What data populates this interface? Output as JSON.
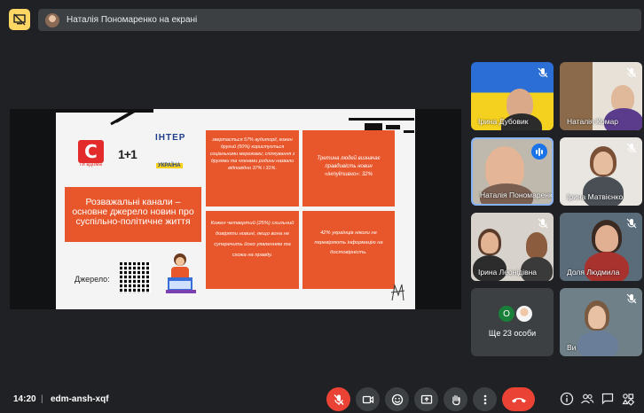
{
  "presenting_banner": {
    "text": "Наталія Пономаренко на екрані"
  },
  "slide": {
    "logos": {
      "stv_mark": "С",
      "stv_sub": "Ти вдома",
      "one_plus_one": "1+1",
      "inter": "ІНТЕР",
      "ukraina": "УКРАЇНА"
    },
    "main_box": "Розважальні канали – основне джерело новин про суспільно-політичне життя",
    "box_tl": "звертається 57% аудиторії, кожен другий (50%) користується соціальними мережами; спілкування з друзями та членами родини назвали відповідно 37% і 31%.",
    "box_tr": "Третина людей визначає правдивість новин «інтуїтивно»: 32%",
    "box_bl": "Кожен четвертий (25%) схильний довіряти новині, якщо вона не суперечить його уявленням та схожа на правду.",
    "box_br": "42% українців ніколи не перевіряють інформацію на достовірність.",
    "source_label": "Джерело:"
  },
  "participants": [
    {
      "name": "Ірина Дубовик",
      "mic": "off"
    },
    {
      "name": "Наталія Комар",
      "mic": "off"
    },
    {
      "name": "Наталія Пономаренко",
      "mic": "speaking"
    },
    {
      "name": "Ірина Матвієнко",
      "mic": "off"
    },
    {
      "name": "Ірина Леонідівна",
      "mic": "off"
    },
    {
      "name": "Доля Людмила",
      "mic": "off"
    },
    {
      "name": "Ще 23 особи",
      "mic": "none",
      "avatar_letter": "О"
    },
    {
      "name": "Ви",
      "mic": "off"
    }
  ],
  "bottom_bar": {
    "time": "14:20",
    "separator": "|",
    "meeting_code": "edm-ansh-xqf"
  },
  "colors": {
    "background": "#202124",
    "slide_accent": "#e8572b",
    "end_call": "#ea4335",
    "present_btn": "#fdd663"
  }
}
